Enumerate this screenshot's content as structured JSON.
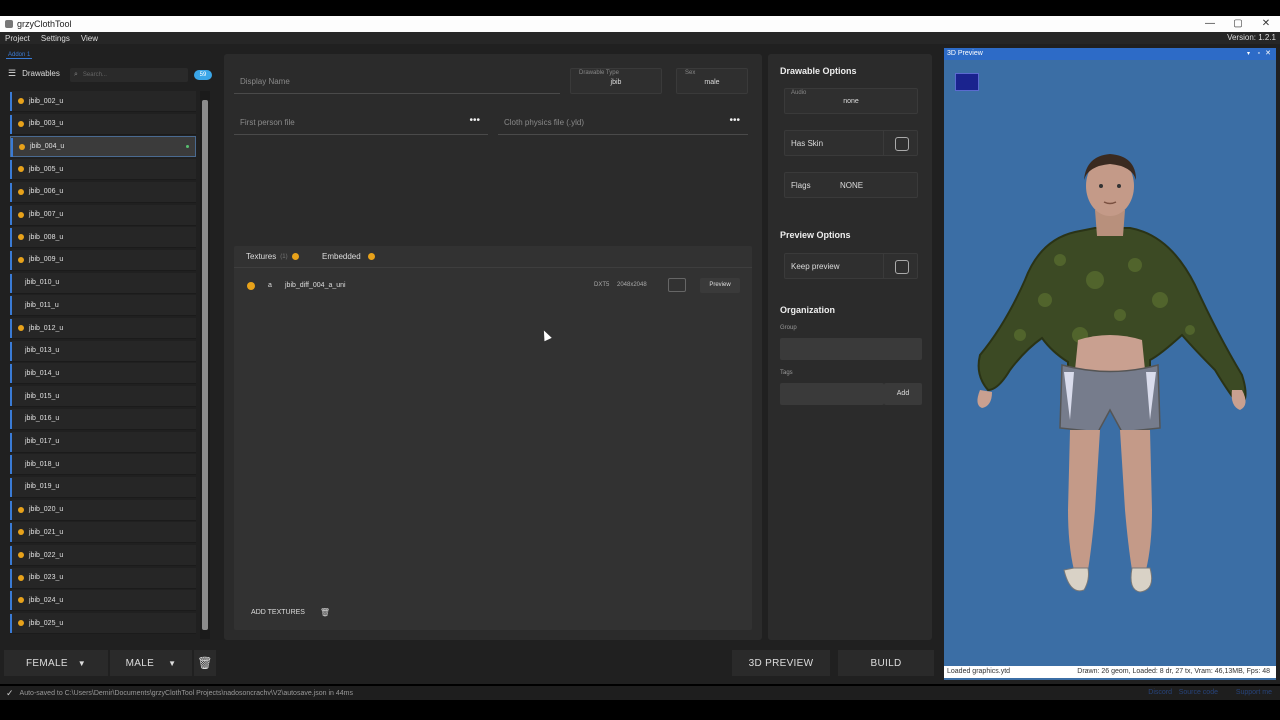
{
  "window": {
    "title": "grzyClothTool",
    "minimize": "—",
    "maximize": "▢",
    "close": "✕"
  },
  "menu": {
    "items": [
      "Project",
      "Settings",
      "View"
    ],
    "version": "Version: 1.2.1"
  },
  "project_tab": "Addon 1",
  "sidebar": {
    "title": "Drawables",
    "search_placeholder": "Search...",
    "count": "59",
    "items": [
      {
        "label": "jbib_002_u",
        "dot": true
      },
      {
        "label": "jbib_003_u",
        "dot": true
      },
      {
        "label": "jbib_004_u",
        "dot": true,
        "selected": true
      },
      {
        "label": "jbib_005_u",
        "dot": true
      },
      {
        "label": "jbib_006_u",
        "dot": true
      },
      {
        "label": "jbib_007_u",
        "dot": true
      },
      {
        "label": "jbib_008_u",
        "dot": true
      },
      {
        "label": "jbib_009_u",
        "dot": true
      },
      {
        "label": "jbib_010_u",
        "dot": false
      },
      {
        "label": "jbib_011_u",
        "dot": false
      },
      {
        "label": "jbib_012_u",
        "dot": true
      },
      {
        "label": "jbib_013_u",
        "dot": false
      },
      {
        "label": "jbib_014_u",
        "dot": false
      },
      {
        "label": "jbib_015_u",
        "dot": false
      },
      {
        "label": "jbib_016_u",
        "dot": false
      },
      {
        "label": "jbib_017_u",
        "dot": false
      },
      {
        "label": "jbib_018_u",
        "dot": false
      },
      {
        "label": "jbib_019_u",
        "dot": false
      },
      {
        "label": "jbib_020_u",
        "dot": true
      },
      {
        "label": "jbib_021_u",
        "dot": true
      },
      {
        "label": "jbib_022_u",
        "dot": true
      },
      {
        "label": "jbib_023_u",
        "dot": true
      },
      {
        "label": "jbib_024_u",
        "dot": true
      },
      {
        "label": "jbib_025_u",
        "dot": true
      }
    ],
    "female_label": "FEMALE",
    "male_label": "MALE"
  },
  "details": {
    "display_name_placeholder": "Display Name",
    "drawable_type_label": "Drawable Type",
    "drawable_type_value": "jbib",
    "sex_label": "Sex",
    "sex_value": "male",
    "first_person_placeholder": "First person file",
    "cloth_physics_placeholder": "Cloth physics file (.yld)",
    "more": "•••"
  },
  "textures": {
    "tab_textures": "Textures",
    "tab_embedded": "Embedded",
    "tab_count": "(1)",
    "rows": [
      {
        "letter": "a",
        "name": "jbib_diff_004_a_uni",
        "format": "DXT5",
        "size": "2048x2048",
        "action": "Preview"
      }
    ],
    "add_label": "ADD TEXTURES",
    "delete_icon": "🗑"
  },
  "options": {
    "drawable_title": "Drawable Options",
    "audio_label": "Audio",
    "audio_value": "none",
    "has_skin": "Has Skin",
    "flags_label": "Flags",
    "flags_value": "NONE",
    "preview_title": "Preview Options",
    "keep_preview": "Keep preview",
    "org_title": "Organization",
    "group_label": "Group",
    "tags_label": "Tags",
    "add_label": "Add"
  },
  "actions": {
    "preview_3d": "3D PREVIEW",
    "build": "BUILD"
  },
  "preview": {
    "title": "3D Preview",
    "status_left": "Loaded graphics.ytd",
    "status_right": "Drawn: 26 geom, Loaded: 8 dr, 27 tx, Vram: 46,13MB, Fps: 48"
  },
  "status": {
    "message": "Auto-saved to C:\\Users\\Demir\\Documents\\grzyClothTool Projects\\nadosoncrachv\\V2\\autosave.json in 44ms",
    "links": [
      "Discord",
      "Source code",
      "Support me"
    ]
  },
  "colors": {
    "accent": "#3a7bd5",
    "orange_dot": "#e8a21a",
    "preview_bg": "#3b6ea5"
  }
}
